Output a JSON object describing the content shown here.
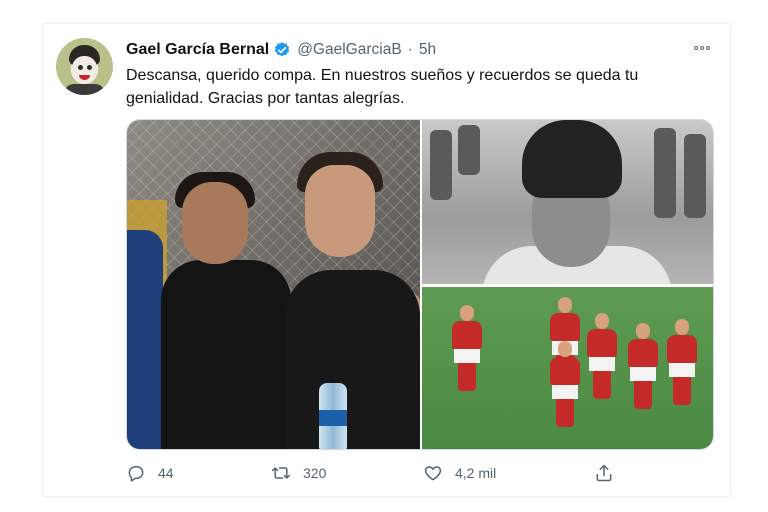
{
  "tweet": {
    "author_name": "Gael García Bernal",
    "handle": "@GaelGarciaB",
    "separator": "·",
    "time": "5h",
    "text_lines": [
      "Descansa, querido compa. En nuestros sueños y recuerdos se queda tu",
      "genialidad. Gracias por tantas alegrías."
    ]
  },
  "actions": {
    "replies": "44",
    "retweets": "320",
    "likes": "4,2 mil"
  },
  "colors": {
    "verified": "#1d9bf0",
    "secondary_text": "#536471",
    "primary_text": "#0f1419"
  },
  "icons": [
    "verified-badge-icon",
    "more-options-icon",
    "reply-icon",
    "retweet-icon",
    "like-icon",
    "share-icon"
  ]
}
